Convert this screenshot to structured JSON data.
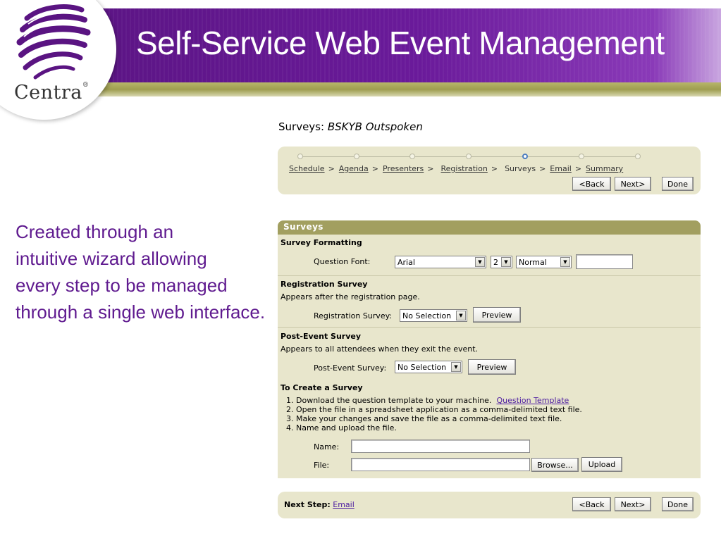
{
  "banner": {
    "title": "Self-Service Web Event Management",
    "logo_text": "Centra",
    "logo_reg": "®"
  },
  "caption": {
    "lines": [
      "Created through an",
      "intuitive wizard allowing",
      "every step to be managed",
      "through a single web interface."
    ]
  },
  "page": {
    "heading_prefix": "Surveys:",
    "heading_event": "BSKYB Outspoken"
  },
  "wizard": {
    "steps": [
      {
        "label": "Schedule",
        "link": true
      },
      {
        "label": "Agenda",
        "link": true
      },
      {
        "label": "Presenters",
        "link": true
      },
      {
        "label": "Registration",
        "link": true
      },
      {
        "label": "Surveys",
        "link": false
      },
      {
        "label": "Email",
        "link": true
      },
      {
        "label": "Summary",
        "link": true
      }
    ],
    "separator": ">",
    "active_step": 4,
    "back_label": "<Back",
    "next_label": "Next>",
    "done_label": "Done"
  },
  "surveys": {
    "panel_title": "Surveys",
    "formatting": {
      "title": "Survey Formatting",
      "font_label": "Question Font:",
      "font_value": "Arial",
      "size_value": "2",
      "style_value": "Normal",
      "color_value": ""
    },
    "registration": {
      "title": "Registration Survey",
      "desc": "Appears after the registration page.",
      "label": "Registration Survey:",
      "value": "No Selection",
      "preview_label": "Preview"
    },
    "post_event": {
      "title": "Post-Event Survey",
      "desc": "Appears to all attendees when they exit the event.",
      "label": "Post-Event Survey:",
      "value": "No Selection",
      "preview_label": "Preview"
    },
    "create": {
      "title": "To Create a Survey",
      "step1": "1. Download the question template to your machine.",
      "step1_link": "Question Template",
      "step2": "2. Open the file in a spreadsheet application as a comma-delimited text file.",
      "step3": "3. Make your changes and save the file as a comma-delimited text file.",
      "step4": "4. Name and upload the file.",
      "name_label": "Name:",
      "name_value": "",
      "file_label": "File:",
      "file_value": "",
      "browse_label": "Browse...",
      "upload_label": "Upload"
    }
  },
  "footer": {
    "next_step_label": "Next Step:",
    "next_step_link": "Email",
    "back_label": "<Back",
    "next_label": "Next>",
    "done_label": "Done"
  }
}
